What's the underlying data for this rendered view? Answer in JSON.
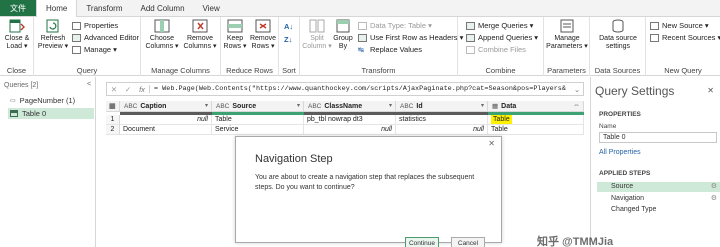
{
  "tabs": [
    "文件",
    "Home",
    "Transform",
    "Add Column",
    "View"
  ],
  "ribbon": {
    "close": {
      "btn": "Close &\nLoad ▾",
      "label": "Close"
    },
    "query": {
      "refresh": "Refresh\nPreview ▾",
      "properties": "Properties",
      "advanced_editor": "Advanced Editor",
      "manage": "Manage ▾",
      "label": "Query"
    },
    "manage_columns": {
      "choose": "Choose\nColumns ▾",
      "remove": "Remove\nColumns ▾",
      "label": "Manage Columns"
    },
    "reduce_rows": {
      "keep": "Keep\nRows ▾",
      "remove": "Remove\nRows ▾",
      "label": "Reduce Rows"
    },
    "sort": {
      "label": "Sort"
    },
    "transform": {
      "split": "Split\nColumn ▾",
      "group_by": "Group\nBy",
      "data_type": "Data Type: Table ▾",
      "first_row": "Use First Row as Headers ▾",
      "replace": "Replace Values",
      "label": "Transform"
    },
    "combine": {
      "merge": "Merge Queries ▾",
      "append": "Append Queries ▾",
      "combine_files": "Combine Files",
      "label": "Combine"
    },
    "parameters": {
      "manage": "Manage\nParameters ▾",
      "label": "Parameters"
    },
    "data_sources": {
      "settings": "Data source\nsettings",
      "label": "Data Sources"
    },
    "new_query": {
      "new_source": "New Source ▾",
      "recent_sources": "Recent Sources ▾",
      "label": "New Query"
    }
  },
  "queries": {
    "header": "Queries [2]",
    "collapse": "<",
    "items": [
      "PageNumber (1)",
      "Table 0"
    ]
  },
  "formula_bar": {
    "cancel": "✕",
    "commit": "✓",
    "fx": "fx",
    "text": "= Web.Page(Web.Contents(\"https://www.quanthockey.com/scripts/AjaxPaginate.php?cat=Season&pos=Players&",
    "expand": "⌄"
  },
  "grid": {
    "columns": [
      {
        "type": "ABC\n123",
        "name": "Caption"
      },
      {
        "type": "ABC\n123",
        "name": "Source"
      },
      {
        "type": "ABC\n123",
        "name": "ClassName"
      },
      {
        "type": "ABC\n123",
        "name": "Id"
      },
      {
        "type": "ABC\n123",
        "name": "Data"
      }
    ],
    "rows": [
      {
        "n": "1",
        "cells": [
          "null",
          "Table",
          "pb_tbl nowrap dt3",
          "statistics",
          "Table"
        ]
      },
      {
        "n": "2",
        "cells": [
          "Document",
          "Service",
          "null",
          "null",
          "Table"
        ]
      }
    ]
  },
  "query_settings": {
    "title": "Query Settings",
    "close": "✕",
    "properties_header": "PROPERTIES",
    "name_label": "Name",
    "name_value": "Table 0",
    "all_properties": "All Properties",
    "applied_steps_header": "APPLIED STEPS",
    "steps": [
      "Source",
      "Navigation",
      "Changed Type"
    ]
  },
  "dialog": {
    "title": "Navigation Step",
    "close": "✕",
    "message": "You are about to create a navigation step that replaces the subsequent steps. Do you want to continue?",
    "continue": "Continue",
    "cancel": "Cancel"
  },
  "watermark": "知乎 @TMMJia",
  "colors": {
    "accent": "#217346",
    "selection": "#cfe9d8",
    "quality_bar": "#3ca173",
    "highlight": "#fff100"
  }
}
